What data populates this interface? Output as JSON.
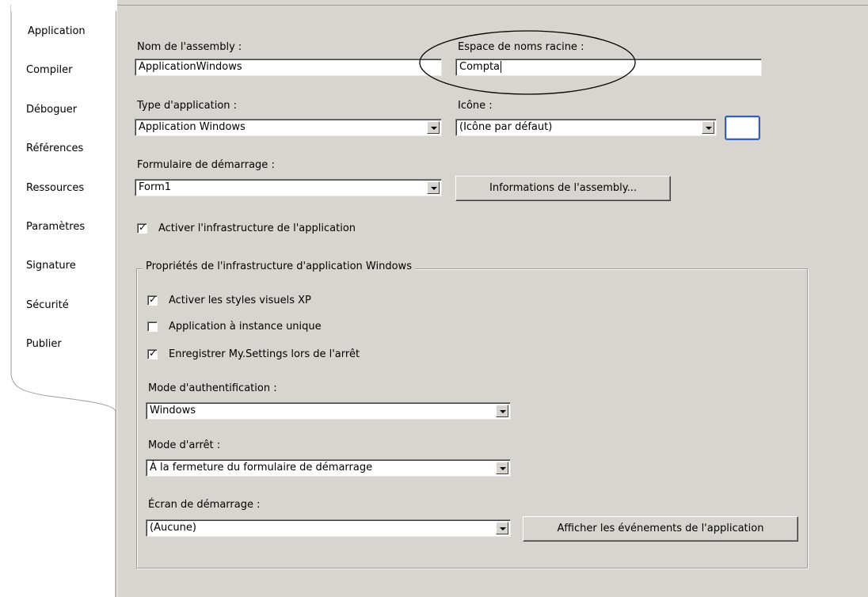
{
  "tabs": [
    {
      "label": "Application",
      "active": true
    },
    {
      "label": "Compiler",
      "active": false
    },
    {
      "label": "Déboguer",
      "active": false
    },
    {
      "label": "Références",
      "active": false
    },
    {
      "label": "Ressources",
      "active": false
    },
    {
      "label": "Paramètres",
      "active": false
    },
    {
      "label": "Signature",
      "active": false
    },
    {
      "label": "Sécurité",
      "active": false
    },
    {
      "label": "Publier",
      "active": false
    }
  ],
  "assembly": {
    "label": "Nom de l'assembly :",
    "value": "ApplicationWindows"
  },
  "root_namespace": {
    "label": "Espace de noms racine :",
    "value": "Compta"
  },
  "app_type": {
    "label": "Type d'application :",
    "value": "Application Windows"
  },
  "icon": {
    "label": "Icône :",
    "value": "(Icône par défaut)"
  },
  "startup_form": {
    "label": "Formulaire de démarrage :",
    "value": "Form1"
  },
  "assembly_info_button": "Informations de l'assembly...",
  "enable_framework": {
    "label": "Activer l'infrastructure de l'application",
    "checked": true
  },
  "framework_group": {
    "title": "Propriétés de l'infrastructure d'application Windows",
    "xp_styles": {
      "label": "Activer les styles visuels XP",
      "checked": true
    },
    "single_instance": {
      "label": "Application à instance unique",
      "checked": false
    },
    "save_settings": {
      "label": "Enregistrer My.Settings lors de l'arrêt",
      "checked": true
    },
    "auth_mode": {
      "label": "Mode d'authentification :",
      "value": "Windows"
    },
    "shutdown_mode": {
      "label": "Mode d'arrêt :",
      "value": "À la fermeture du formulaire de démarrage"
    },
    "splash_screen": {
      "label": "Écran de démarrage :",
      "value": "(Aucune)"
    },
    "view_events_button": "Afficher les événements de l'application"
  },
  "colors": {
    "background": "#d8d4cf",
    "annotation": "#000000",
    "icon_border": "#3b5fb0"
  }
}
